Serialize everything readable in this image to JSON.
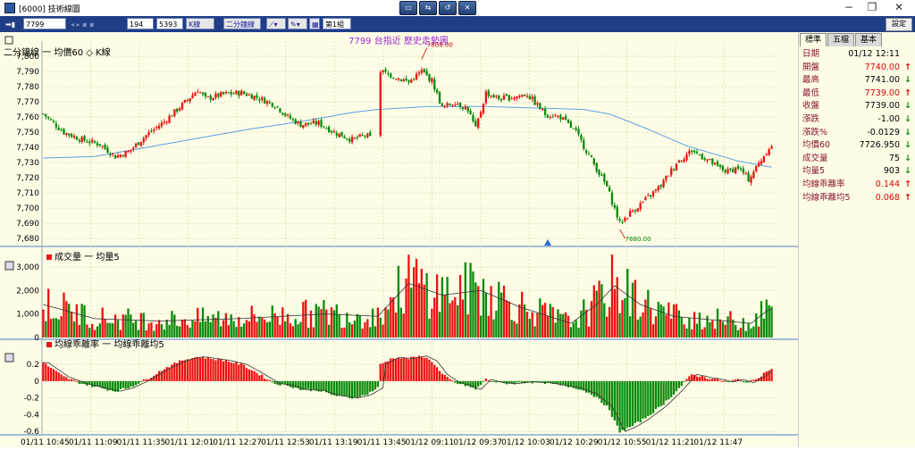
{
  "window": {
    "title": "[6000] 技術線圖"
  },
  "toolbar": {
    "symbol": "7799",
    "interval_value": "194",
    "count_value": "5393",
    "chart_type": "K線",
    "period": "二分鐘線",
    "group": "第1組",
    "settings_label": "設定"
  },
  "colors": {
    "up": "#ee1111",
    "down": "#0a8a0a",
    "ma": "#5aa0e0",
    "grid": "#e3e3c2",
    "axis": "#4a7ac8"
  },
  "sidebar": {
    "tabs": [
      "標準",
      "五檔",
      "基本"
    ],
    "rows": [
      {
        "label": "日期",
        "value": "01/12 12:11",
        "arrow": "",
        "color": "#000000"
      },
      {
        "label": "開盤",
        "value": "7740.00",
        "arrow": "↑",
        "color": "#e00000"
      },
      {
        "label": "最高",
        "value": "7741.00",
        "arrow": "↓",
        "color": "#000000"
      },
      {
        "label": "最低",
        "value": "7739.00",
        "arrow": "↑",
        "color": "#e00000"
      },
      {
        "label": "收盤",
        "value": "7739.00",
        "arrow": "↓",
        "color": "#000000"
      },
      {
        "label": "漲跌",
        "value": "-1.00",
        "arrow": "↓",
        "color": "#000000"
      },
      {
        "label": "漲跌%",
        "value": "-0.0129",
        "arrow": "↓",
        "color": "#000000"
      },
      {
        "label": "均價60",
        "value": "7726.950",
        "arrow": "↓",
        "color": "#000000"
      },
      {
        "label": "成交量",
        "value": "75",
        "arrow": "↓",
        "color": "#000000"
      },
      {
        "label": "均量5",
        "value": "903",
        "arrow": "↓",
        "color": "#000000"
      },
      {
        "label": "均線乖離率",
        "value": "0.144",
        "arrow": "↑",
        "color": "#e00000"
      },
      {
        "label": "均線乖離均5",
        "value": "0.068",
        "arrow": "↑",
        "color": "#e00000"
      }
    ]
  },
  "chart_data": {
    "type": "candlestick",
    "title": "7799 台指近 歷史走勢圖",
    "price_panel": {
      "legend": [
        "二分鐘線",
        "均價60",
        "K線"
      ],
      "ylim": [
        7676,
        7810
      ],
      "yticks": [
        7680,
        7690,
        7700,
        7710,
        7720,
        7730,
        7740,
        7750,
        7760,
        7770,
        7780,
        7790,
        7800
      ],
      "annotations": [
        "7808.00",
        "7680.00"
      ],
      "keyframes": [
        [
          0,
          7762
        ],
        [
          8,
          7750
        ],
        [
          15,
          7745
        ],
        [
          22,
          7742
        ],
        [
          28,
          7734
        ],
        [
          33,
          7737
        ],
        [
          40,
          7748
        ],
        [
          47,
          7757
        ],
        [
          54,
          7768
        ],
        [
          60,
          7778
        ],
        [
          63,
          7772
        ],
        [
          70,
          7775
        ],
        [
          77,
          7776
        ],
        [
          83,
          7773
        ],
        [
          90,
          7768
        ],
        [
          95,
          7760
        ],
        [
          100,
          7755
        ],
        [
          107,
          7756
        ],
        [
          113,
          7750
        ],
        [
          120,
          7745
        ],
        [
          125,
          7748
        ],
        [
          130,
          7744
        ],
        [
          131,
          7790
        ],
        [
          136,
          7787
        ],
        [
          142,
          7783
        ],
        [
          147,
          7790
        ],
        [
          151,
          7784
        ],
        [
          155,
          7766
        ],
        [
          160,
          7770
        ],
        [
          165,
          7765
        ],
        [
          168,
          7752
        ],
        [
          172,
          7776
        ],
        [
          177,
          7772
        ],
        [
          182,
          7773
        ],
        [
          188,
          7775
        ],
        [
          195,
          7762
        ],
        [
          201,
          7760
        ],
        [
          207,
          7750
        ],
        [
          213,
          7732
        ],
        [
          219,
          7714
        ],
        [
          224,
          7690
        ],
        [
          228,
          7697
        ],
        [
          233,
          7704
        ],
        [
          240,
          7715
        ],
        [
          246,
          7730
        ],
        [
          252,
          7738
        ],
        [
          258,
          7732
        ],
        [
          262,
          7727
        ],
        [
          266,
          7724
        ],
        [
          270,
          7727
        ],
        [
          274,
          7719
        ],
        [
          279,
          7732
        ],
        [
          282,
          7740
        ]
      ],
      "ma_keyframes": [
        [
          0,
          7733
        ],
        [
          20,
          7734
        ],
        [
          40,
          7740
        ],
        [
          60,
          7746
        ],
        [
          80,
          7752
        ],
        [
          100,
          7757
        ],
        [
          120,
          7763
        ],
        [
          130,
          7765
        ],
        [
          150,
          7767
        ],
        [
          170,
          7767
        ],
        [
          190,
          7766
        ],
        [
          210,
          7765
        ],
        [
          220,
          7762
        ],
        [
          235,
          7752
        ],
        [
          250,
          7741
        ],
        [
          270,
          7731
        ],
        [
          283,
          7727
        ]
      ]
    },
    "volume_panel": {
      "legend": [
        "成交量",
        "均量5"
      ],
      "ylim": [
        0,
        3300
      ],
      "yticks": [
        1000,
        2000,
        3000
      ],
      "keyframes": [
        [
          0,
          1400
        ],
        [
          20,
          800
        ],
        [
          45,
          700
        ],
        [
          75,
          800
        ],
        [
          110,
          1000
        ],
        [
          130,
          900
        ],
        [
          142,
          2300
        ],
        [
          155,
          1800
        ],
        [
          170,
          2000
        ],
        [
          185,
          1300
        ],
        [
          205,
          600
        ],
        [
          215,
          1400
        ],
        [
          222,
          2200
        ],
        [
          232,
          1400
        ],
        [
          245,
          900
        ],
        [
          265,
          700
        ],
        [
          275,
          600
        ],
        [
          282,
          1200
        ]
      ]
    },
    "deviation_panel": {
      "legend": [
        "均線乖離率",
        "均線乖離均5"
      ],
      "ylim": [
        -0.63,
        0.35
      ],
      "yticks": [
        0.2,
        0,
        -0.2,
        -0.4,
        -0.6
      ],
      "keyframes": [
        [
          0,
          0.22
        ],
        [
          8,
          0.05
        ],
        [
          15,
          -0.03
        ],
        [
          22,
          -0.08
        ],
        [
          28,
          -0.12
        ],
        [
          33,
          -0.08
        ],
        [
          40,
          0.02
        ],
        [
          47,
          0.15
        ],
        [
          54,
          0.25
        ],
        [
          60,
          0.29
        ],
        [
          63,
          0.28
        ],
        [
          70,
          0.25
        ],
        [
          77,
          0.2
        ],
        [
          83,
          0.1
        ],
        [
          90,
          -0.03
        ],
        [
          95,
          -0.05
        ],
        [
          100,
          -0.1
        ],
        [
          107,
          -0.11
        ],
        [
          113,
          -0.17
        ],
        [
          120,
          -0.2
        ],
        [
          125,
          -0.17
        ],
        [
          130,
          -0.08
        ],
        [
          131,
          0.2
        ],
        [
          136,
          0.28
        ],
        [
          142,
          0.27
        ],
        [
          147,
          0.3
        ],
        [
          151,
          0.24
        ],
        [
          155,
          0.08
        ],
        [
          160,
          -0.02
        ],
        [
          165,
          -0.06
        ],
        [
          168,
          -0.1
        ],
        [
          172,
          0.02
        ],
        [
          177,
          -0.02
        ],
        [
          182,
          -0.03
        ],
        [
          188,
          -0.01
        ],
        [
          195,
          -0.02
        ],
        [
          201,
          -0.05
        ],
        [
          207,
          -0.08
        ],
        [
          213,
          -0.15
        ],
        [
          219,
          -0.3
        ],
        [
          224,
          -0.6
        ],
        [
          228,
          -0.55
        ],
        [
          233,
          -0.46
        ],
        [
          240,
          -0.3
        ],
        [
          246,
          -0.12
        ],
        [
          252,
          0.08
        ],
        [
          258,
          0.04
        ],
        [
          262,
          0.02
        ],
        [
          266,
          -0.01
        ],
        [
          270,
          0.02
        ],
        [
          274,
          -0.02
        ],
        [
          279,
          0.07
        ],
        [
          282,
          0.14
        ]
      ]
    },
    "x_labels": [
      "01/11 10:45",
      "01/11 11:09",
      "01/11 11:35",
      "01/11 12:01",
      "01/11 12:27",
      "01/11 12:53",
      "01/11 13:19",
      "01/11 13:45",
      "01/12 09:11",
      "01/12 09:37",
      "01/12 10:03",
      "01/12 10:29",
      "01/12 10:55",
      "01/12 11:21",
      "01/12 11:47"
    ]
  }
}
